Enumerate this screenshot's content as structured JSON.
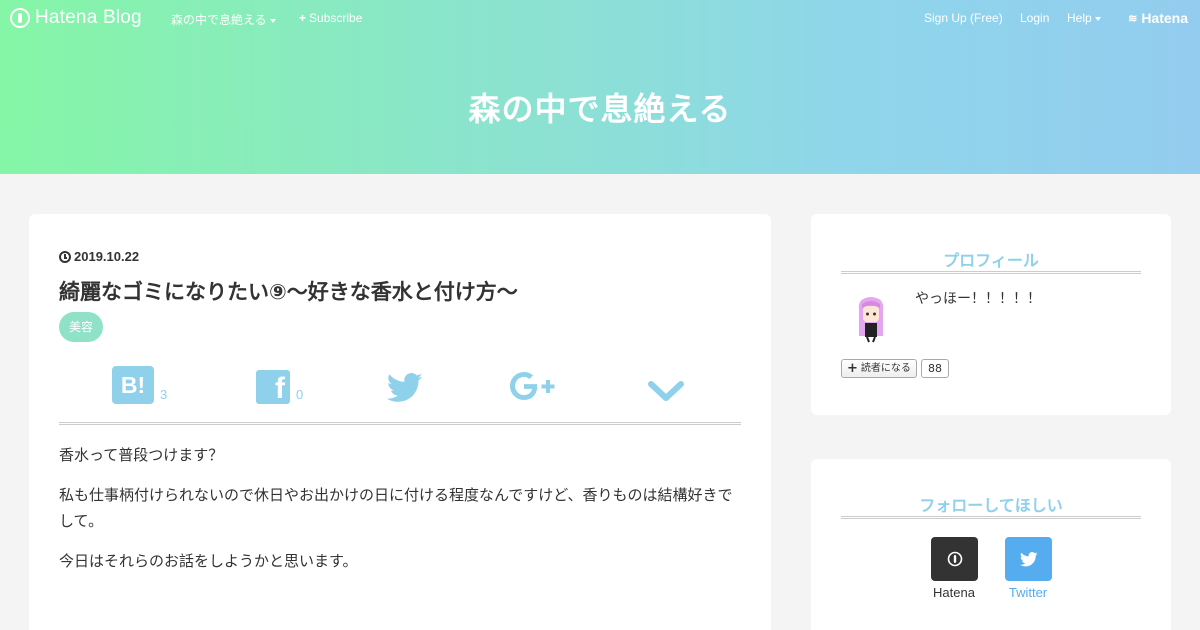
{
  "topbar": {
    "brand": "Hatena Blog",
    "blog_menu": "森の中で息絶える",
    "subscribe": "Subscribe",
    "signup": "Sign Up (Free)",
    "login": "Login",
    "help": "Help",
    "hatena": "Hatena"
  },
  "header": {
    "blog_title": "森の中で息絶える"
  },
  "colors": {
    "gradient_start": "#85f6a6",
    "gradient_end": "#93ccef",
    "accent": "#8fd0ea",
    "category_bg": "#8fe2c8"
  },
  "article": {
    "date": "2019.10.22",
    "title": "綺麗なゴミになりたい⑨～好きな香水と付け方～",
    "category": "美容",
    "share": {
      "hatena_bookmark_label": "B!",
      "hatena_bookmark_count": "3",
      "facebook_label": "f",
      "facebook_count": "0",
      "icons": [
        "hatena-bookmark-icon",
        "facebook-icon",
        "twitter-icon",
        "google-plus-icon",
        "chevron-down-icon"
      ]
    },
    "paragraphs": [
      "香水って普段つけます？",
      "私も仕事柄付けられないので休日やお出かけの日に付ける程度なんですけど、香りものは結構好きでして。",
      "今日はそれらのお話をしようかと思います。"
    ]
  },
  "sidebar": {
    "profile": {
      "title": "プロフィール",
      "message": "やっほー！！！！！",
      "reader_button": "読者になる",
      "reader_count": "88"
    },
    "follow": {
      "title": "フォローしてほしい",
      "hatena_label": "Hatena",
      "twitter_label": "Twitter"
    }
  }
}
